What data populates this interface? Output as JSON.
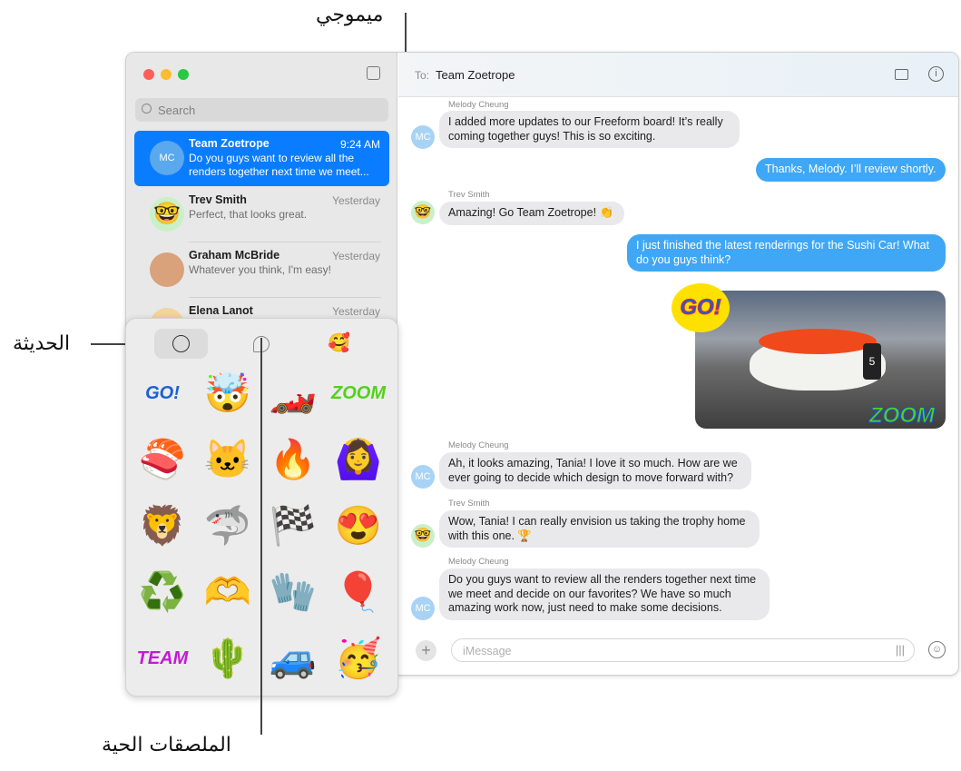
{
  "callouts": {
    "memoji": "ميموجي",
    "recent": "الحديثة",
    "live_stickers": "الملصقات الحية"
  },
  "sidebar": {
    "search_placeholder": "Search",
    "conversations": [
      {
        "name": "Team Zoetrope",
        "time": "9:24 AM",
        "preview": "Do you guys want to review all the renders together next time we meet...",
        "avatar": "MC",
        "selected": true
      },
      {
        "name": "Trev Smith",
        "time": "Yesterday",
        "preview": "Perfect, that looks great."
      },
      {
        "name": "Graham McBride",
        "time": "Yesterday",
        "preview": "Whatever you think, I'm easy!"
      },
      {
        "name": "Elena Lanot",
        "time": "Yesterday",
        "preview": ""
      }
    ]
  },
  "header": {
    "to_label": "To:",
    "recipient": "Team Zoetrope"
  },
  "messages": [
    {
      "sender": "Melody Cheung",
      "avatar": "MC",
      "text": "I added more updates to our Freeform board! It’s really coming together guys! This is so exciting."
    },
    {
      "sender": "me",
      "text": "Thanks, Melody. I’ll review shortly."
    },
    {
      "sender": "Trev Smith",
      "text": "Amazing! Go Team Zoetrope! 👏"
    },
    {
      "sender": "me",
      "text": "I just finished the latest renderings for the Sushi Car! What do you guys think?"
    },
    {
      "sender": "Melody Cheung",
      "avatar": "MC",
      "text": "Ah, it looks amazing, Tania! I love it so much. How are we ever going to decide which design to move forward with?"
    },
    {
      "sender": "Trev Smith",
      "text": "Wow, Tania! I can really envision us taking the trophy home with this one. 🏆"
    },
    {
      "sender": "Melody Cheung",
      "avatar": "MC",
      "text": "Do you guys want to review all the renders together next time we meet and decide on our favorites? We have so much amazing work now, just need to make some decisions."
    }
  ],
  "image_stickers": {
    "go": "GO!",
    "zoom": "ZOOM",
    "car_number": "5"
  },
  "composer": {
    "placeholder": "iMessage"
  },
  "stickers": [
    "GO!",
    "🤯",
    "🏎️",
    "ZOOM",
    "🍣",
    "🐱",
    "🔥",
    "🙆‍♀️",
    "🦁",
    "🦈",
    "🏁",
    "😍",
    "♻️",
    "🫶",
    "🧤",
    "🎈",
    "TEAM",
    "🌵",
    "🚙",
    "🥳"
  ],
  "colors": {
    "accent": "#0a7cff",
    "outgoing": "#3fa7f5",
    "incoming": "#e9e9eb"
  }
}
